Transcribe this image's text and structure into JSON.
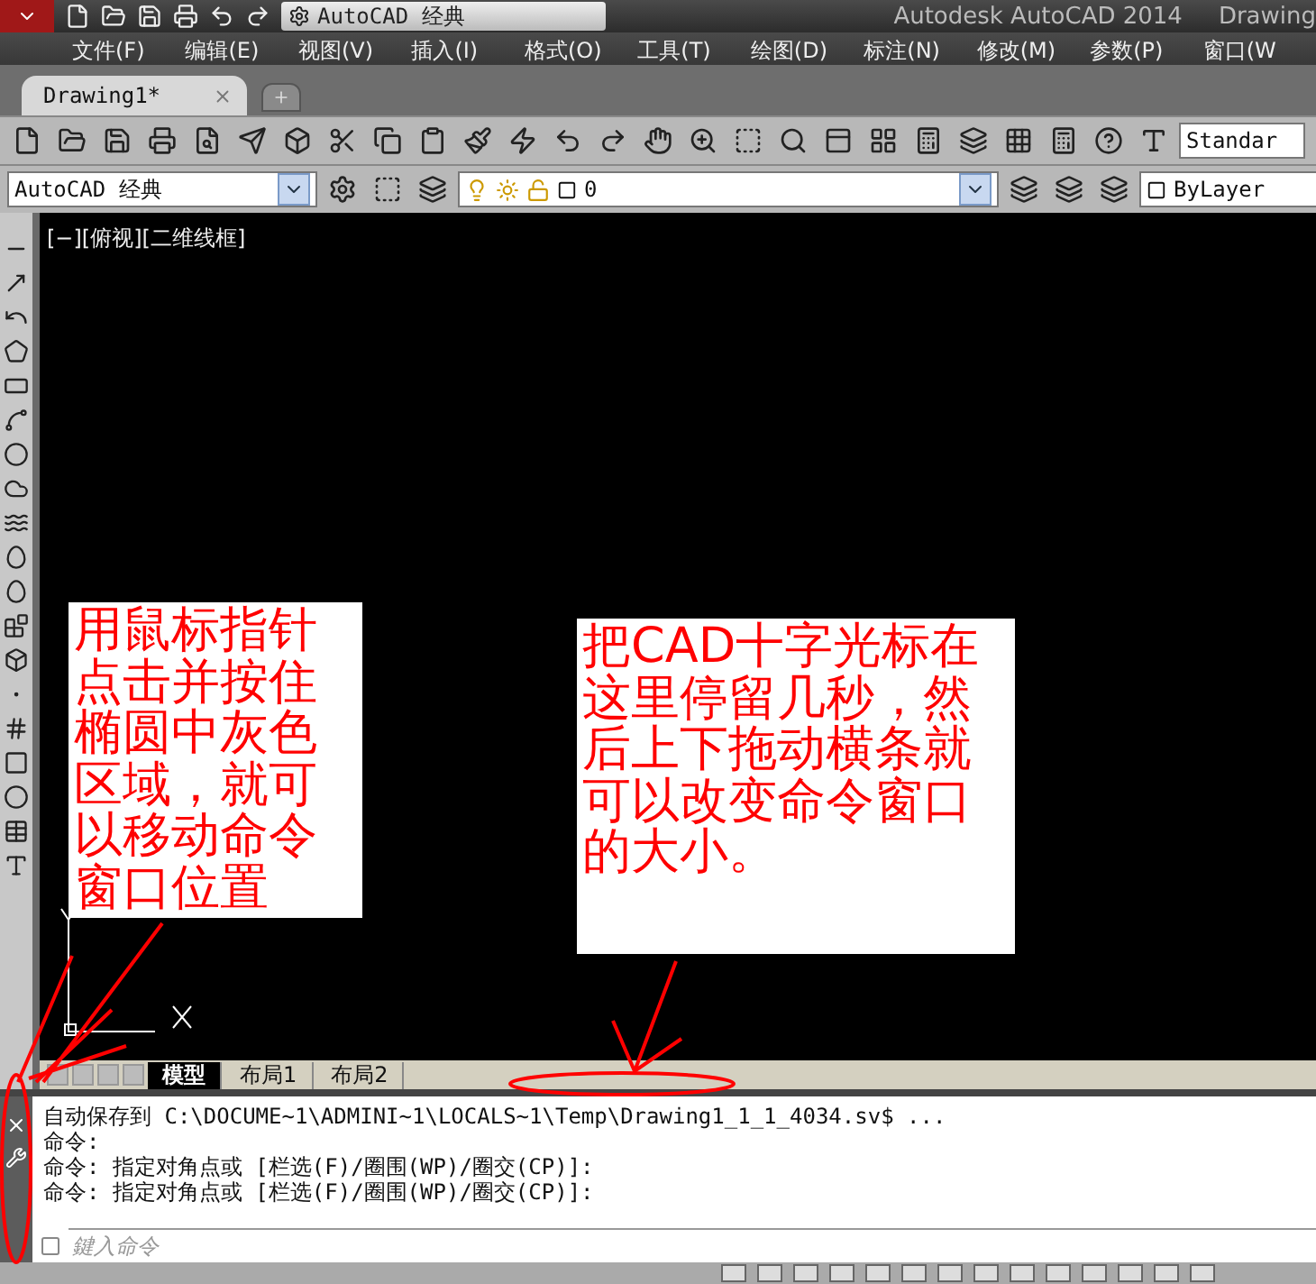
{
  "title_bar": {
    "workspace": "AutoCAD 经典",
    "app_title": "Autodesk AutoCAD 2014",
    "document": "Drawing"
  },
  "menu": [
    "文件(F)",
    "编辑(E)",
    "视图(V)",
    "插入(I)",
    "格式(O)",
    "工具(T)",
    "绘图(D)",
    "标注(N)",
    "修改(M)",
    "参数(P)",
    "窗口(W"
  ],
  "document_tabs": [
    {
      "label": "Drawing1*",
      "selected": true
    }
  ],
  "toolbar": {
    "text_style": "Standar"
  },
  "properties_bar": {
    "workspace": "AutoCAD 经典",
    "layer": "0",
    "color_control": "ByLayer"
  },
  "viewport": {
    "label": "[−][俯视][二维线框]"
  },
  "notes": [
    {
      "text": "用鼠标指针点击并按住椭圆中灰色区域，就可以移动命令窗口位置"
    },
    {
      "text": "把CAD十字光标在这里停留几秒，然后上下拖动横条就可以改变命令窗口的大小。"
    }
  ],
  "layout_tabs": [
    {
      "label": "模型",
      "selected": true
    },
    {
      "label": "布局1",
      "selected": false
    },
    {
      "label": "布局2",
      "selected": false
    }
  ],
  "command_history": [
    "自动保存到 C:\\DOCUME~1\\ADMINI~1\\LOCALS~1\\Temp\\Drawing1_1_1_4034.sv$ ...",
    "命令:",
    "命令: 指定对角点或 [栏选(F)/圈围(WP)/圈交(CP)]:",
    "命令: 指定对角点或 [栏选(F)/圈围(WP)/圈交(CP)]:"
  ],
  "command_input": {
    "placeholder": "鍵入命令"
  }
}
